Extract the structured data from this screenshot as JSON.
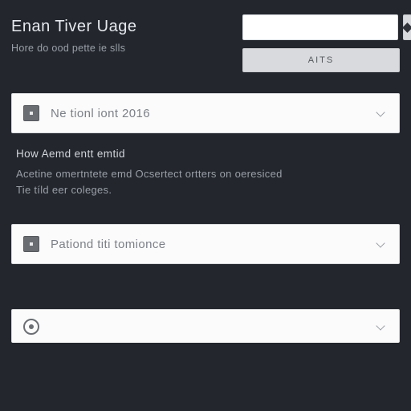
{
  "header": {
    "title": "Enan Tiver Uage",
    "subtitle": "Hore do ood pette ie slls"
  },
  "search": {
    "value": "",
    "placeholder": ""
  },
  "filter_label": "AITS",
  "accordions": [
    {
      "label": "Ne tionl iont 2016"
    },
    {
      "label": "Pationd titi tomionce"
    },
    {
      "label": ""
    }
  ],
  "section": {
    "heading": "How Aemd entt emtid",
    "line1": "Acetine omertntete emd Ocsertect ortters on oeresiced",
    "line2": "Tie tíld eer coleges."
  }
}
